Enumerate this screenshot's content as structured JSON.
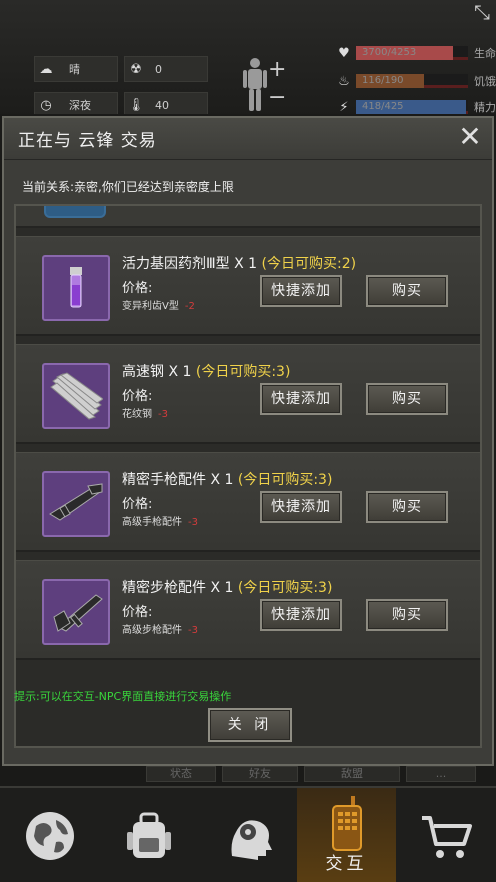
{
  "status": {
    "weather": "晴",
    "radiation": "0",
    "time_of_day": "深夜",
    "temperature": "40",
    "bars": [
      {
        "icon": "heart-icon",
        "value": "3700/4253",
        "label": "生命",
        "color": "#a84a4a",
        "fraction": 0.87
      },
      {
        "icon": "stomach-icon",
        "value": "116/190",
        "label": "饥饿",
        "color": "#7a4a2a",
        "fraction": 0.61
      },
      {
        "icon": "energy-icon",
        "value": "418/425",
        "label": "精力",
        "color": "#3a5a8a",
        "fraction": 0.98
      }
    ]
  },
  "dialog": {
    "title": "正在与 云锋 交易",
    "relation": "当前关系:亲密,你们已经达到亲密度上限",
    "hint": "提示:可以在交互-NPC界面直接进行交易操作",
    "close_label": "关 闭"
  },
  "items": [
    {
      "name": "活力基因药剂Ⅲ型 X 1",
      "limit": "(今日可购买:2)",
      "price_label": "价格:",
      "price_item": "变异利齿Ⅴ型",
      "price_qty": "-2",
      "quick_label": "快捷添加",
      "buy_label": "购买",
      "icon": "vial-icon"
    },
    {
      "name": "高速钢 X 1",
      "limit": "(今日可购买:3)",
      "price_label": "价格:",
      "price_item": "花纹钢",
      "price_qty": "-3",
      "quick_label": "快捷添加",
      "buy_label": "购买",
      "icon": "steel-bars-icon"
    },
    {
      "name": "精密手枪配件 X 1",
      "limit": "(今日可购买:3)",
      "price_label": "价格:",
      "price_item": "高级手枪配件",
      "price_qty": "-3",
      "quick_label": "快捷添加",
      "buy_label": "购买",
      "icon": "pistol-part-icon"
    },
    {
      "name": "精密步枪配件 X 1",
      "limit": "(今日可购买:3)",
      "price_label": "价格:",
      "price_item": "高级步枪配件",
      "price_qty": "-3",
      "quick_label": "快捷添加",
      "buy_label": "购买",
      "icon": "rifle-part-icon"
    }
  ],
  "under_tabs": [
    "状态",
    "好友",
    "敌盟",
    "..."
  ],
  "nav": [
    {
      "icon": "globe-icon",
      "label": ""
    },
    {
      "icon": "backpack-icon",
      "label": ""
    },
    {
      "icon": "brain-head-icon",
      "label": ""
    },
    {
      "icon": "walkie-talkie-icon",
      "label": "交互",
      "active": true
    },
    {
      "icon": "cart-icon",
      "label": ""
    }
  ]
}
